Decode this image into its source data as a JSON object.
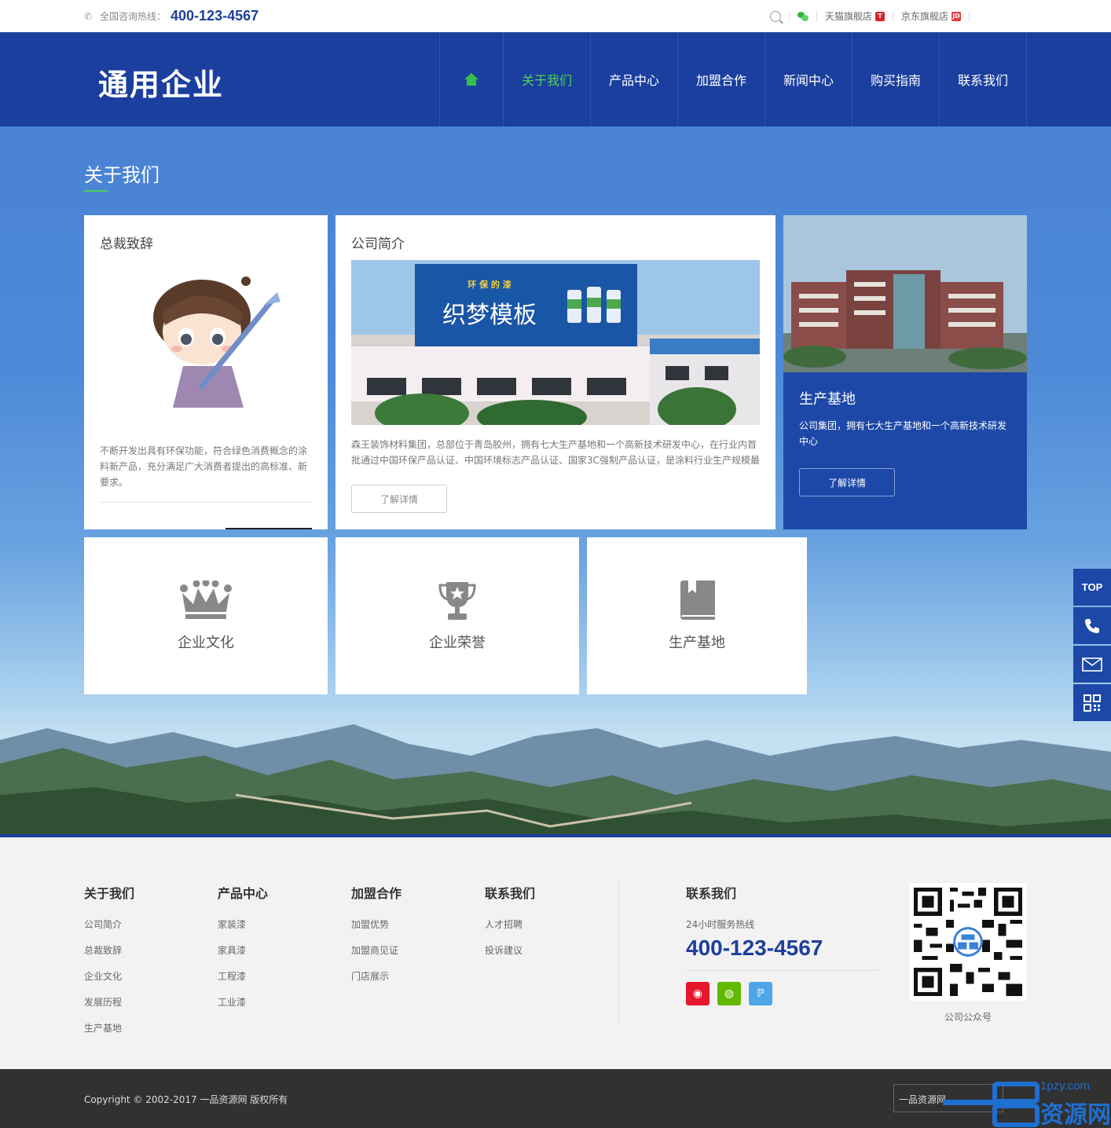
{
  "topbar": {
    "hotline_label": "全国咨询热线：",
    "hotline": "400-123-4567",
    "tmall": "天猫旗舰店",
    "jd": "京东旗舰店",
    "jd_badge": "JD"
  },
  "header": {
    "logo": "通用企业",
    "nav": [
      "关于我们",
      "产品中心",
      "加盟合作",
      "新闻中心",
      "购买指南",
      "联系我们"
    ],
    "active_index": 0
  },
  "about": {
    "title": "关于我们",
    "ceo": {
      "title": "总裁致辞",
      "text": "不断开发出具有环保功能，符合绿色消费概念的涂料新产品，充分满足广大消费者提出的高标准、新要求。"
    },
    "intro": {
      "title": "公司简介",
      "banner_top": "环 保 的 漆",
      "banner_main": "织梦模板",
      "text": "森王装饰材料集团，总部位于青岛胶州，拥有七大生产基地和一个高新技术研发中心，在行业内首批通过中国环保产品认证、中国环境标志产品认证、国家3C强制产品认证，是涂料行业生产规模最",
      "button": "了解详情"
    },
    "base": {
      "title": "生产基地",
      "text": "公司集团，拥有七大生产基地和一个高新技术研发中心",
      "button": "了解详情"
    },
    "icons": [
      {
        "label": "企业文化",
        "icon": "crown-icon"
      },
      {
        "label": "企业荣誉",
        "icon": "trophy-icon"
      },
      {
        "label": "生产基地",
        "icon": "book-icon"
      }
    ]
  },
  "side": {
    "top": "TOP"
  },
  "footer": {
    "cols": [
      {
        "title": "关于我们",
        "links": [
          "公司简介",
          "总裁致辞",
          "企业文化",
          "发展历程",
          "生产基地"
        ]
      },
      {
        "title": "产品中心",
        "links": [
          "家装漆",
          "家具漆",
          "工程漆",
          "工业漆"
        ]
      },
      {
        "title": "加盟合作",
        "links": [
          "加盟优势",
          "加盟商见证",
          "门店展示"
        ]
      },
      {
        "title": "联系我们",
        "links": [
          "人才招聘",
          "投诉建议"
        ]
      }
    ],
    "contact_title": "联系我们",
    "service_label": "24小时服务热线",
    "service_phone": "400-123-4567",
    "qr_caption": "公司公众号",
    "copyright": "Copyright © 2002-2017 一品资源网 版权所有",
    "select_value": "一品资源网",
    "watermark_url": "1pzy.com",
    "watermark_text": "资源网"
  },
  "colors": {
    "primary": "#1b3f9e",
    "accent_green": "#4fd05a"
  }
}
